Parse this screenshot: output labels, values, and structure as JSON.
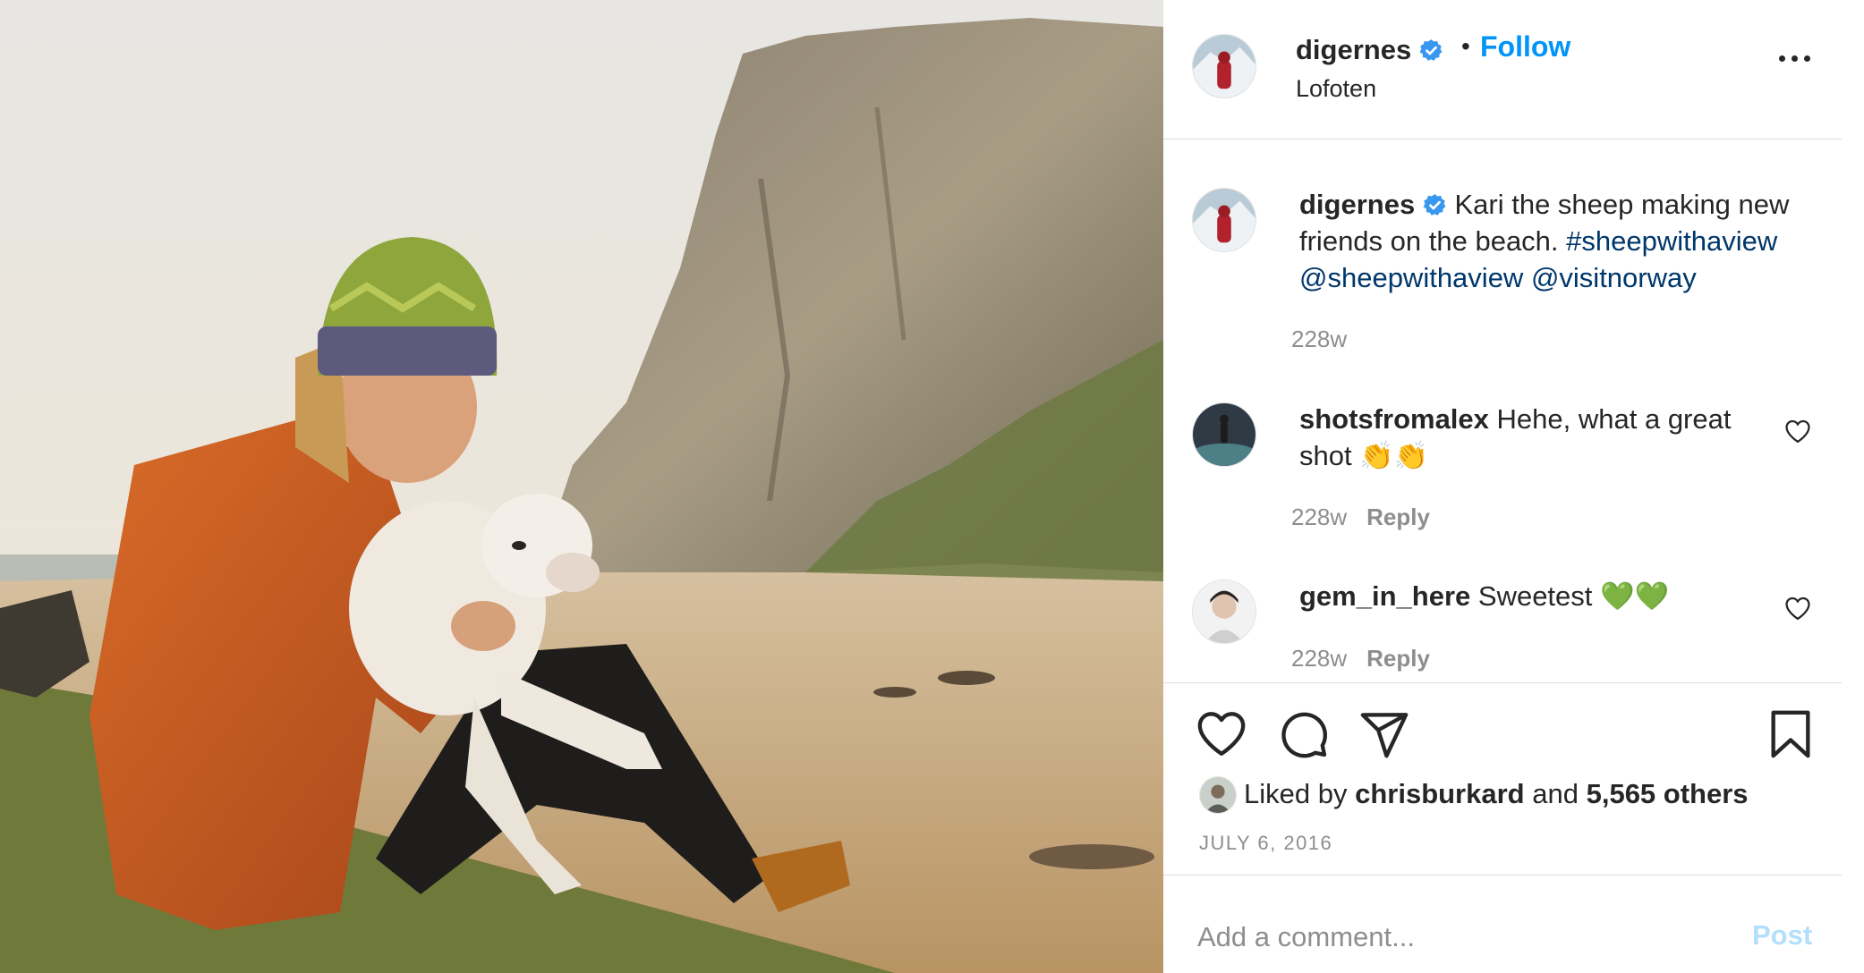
{
  "header": {
    "username": "digernes",
    "dot": "•",
    "follow_label": "Follow",
    "location": "Lofoten",
    "more_icon": "more-horizontal-icon"
  },
  "post": {
    "image_alt": "Man in orange jacket holding a lamb on a beach below a cliff",
    "caption_user": "digernes",
    "caption_text": "Kari the sheep making new friends on the beach.",
    "caption_hashtag": "#sheepwithaview",
    "caption_mention_1": "@sheepwithaview",
    "caption_mention_2": "@visitnorway",
    "caption_age": "228w"
  },
  "comments": [
    {
      "user": "shotsfromalex",
      "text": "Hehe, what a great shot 👏👏",
      "age": "228w",
      "reply_label": "Reply"
    },
    {
      "user": "gem_in_here",
      "text": "Sweetest 💚💚",
      "age": "228w",
      "reply_label": "Reply"
    }
  ],
  "actions": {
    "like_icon": "heart-icon",
    "comment_icon": "comment-icon",
    "share_icon": "send-icon",
    "save_icon": "bookmark-icon"
  },
  "likes": {
    "prefix": "Liked by",
    "user": "chrisburkard",
    "and": "and",
    "others": "5,565 others"
  },
  "date": "JULY 6, 2016",
  "comment_box": {
    "placeholder": "Add a comment...",
    "post_label": "Post"
  },
  "colors": {
    "link_blue": "#0095f6",
    "text": "#262626",
    "muted": "#8e8e8e",
    "verified": "#3897f0",
    "post_disabled": "#b2dffc"
  }
}
